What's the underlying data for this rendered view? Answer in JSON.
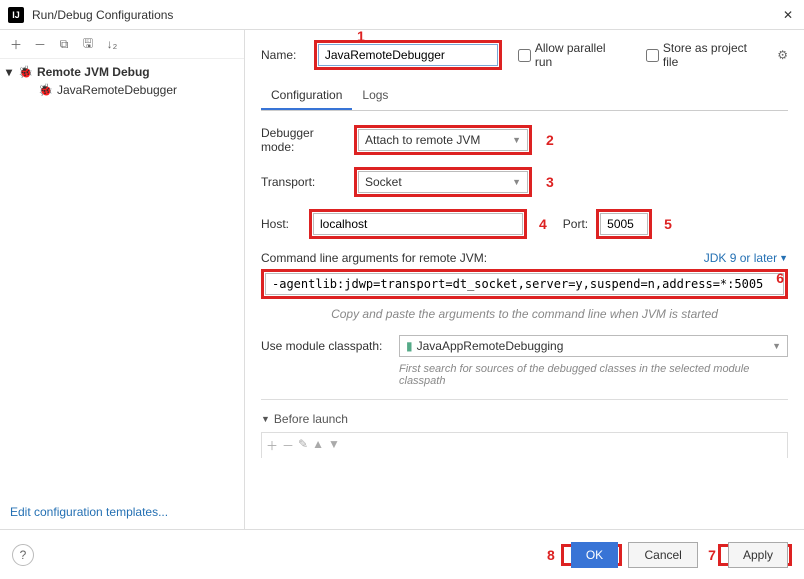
{
  "titlebar": {
    "title": "Run/Debug Configurations"
  },
  "sidebar": {
    "group": "Remote JVM Debug",
    "item": "JavaRemoteDebugger",
    "editLink": "Edit configuration templates..."
  },
  "form": {
    "nameLabel": "Name:",
    "nameValue": "JavaRemoteDebugger",
    "allowParallel": "Allow parallel run",
    "storeProject": "Store as project file",
    "tabs": {
      "config": "Configuration",
      "logs": "Logs"
    },
    "debuggerModeLabel": "Debugger mode:",
    "debuggerModeValue": "Attach to remote JVM",
    "transportLabel": "Transport:",
    "transportValue": "Socket",
    "hostLabel": "Host:",
    "hostValue": "localhost",
    "portLabel": "Port:",
    "portValue": "5005",
    "cmdLabel": "Command line arguments for remote JVM:",
    "jdkLink": "JDK 9 or later",
    "cmdValue": "-agentlib:jdwp=transport=dt_socket,server=y,suspend=n,address=*:5005",
    "copyHint": "Copy and paste the arguments to the command line when JVM is started",
    "classpathLabel": "Use module classpath:",
    "classpathValue": "JavaAppRemoteDebugging",
    "classpathHint": "First search for sources of the debugged classes in the selected module classpath",
    "beforeLaunch": "Before launch"
  },
  "annotations": {
    "a1": "1",
    "a2": "2",
    "a3": "3",
    "a4": "4",
    "a5": "5",
    "a6": "6",
    "a7": "7",
    "a8": "8"
  },
  "footer": {
    "ok": "OK",
    "cancel": "Cancel",
    "apply": "Apply"
  }
}
